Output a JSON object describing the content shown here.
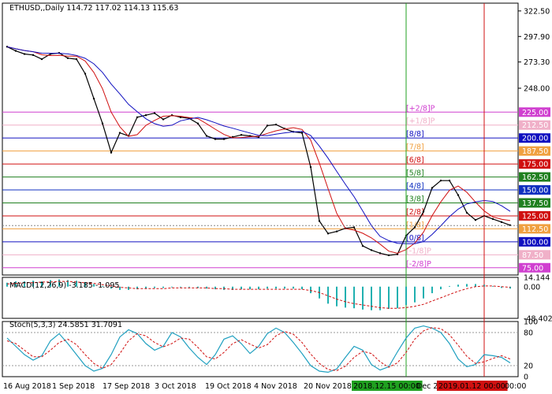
{
  "chart_data": {
    "type": "line",
    "symbol": "ETHUSD",
    "timeframe": "Daily",
    "ohlc_header": "ETHUSD,,Daily  114.72 117.02 114.13 115.63",
    "price_ylim": [
      68,
      330
    ],
    "price_ticks": [
      {
        "value": 322.5,
        "label": "322.50"
      },
      {
        "value": 297.9,
        "label": "297.90"
      },
      {
        "value": 273.3,
        "label": "273.30"
      },
      {
        "value": 248.0,
        "label": "248.00"
      }
    ],
    "current_price": {
      "value": 115.63,
      "label": "115.63"
    },
    "murrey_levels": [
      {
        "value": 225.0,
        "name": "[+2/8]P",
        "price_label": "225.00",
        "color": "#d040d0"
      },
      {
        "value": 212.5,
        "name": "[+1/8]P",
        "price_label": "212.50",
        "color": "#f0b0c8"
      },
      {
        "value": 200.0,
        "name": "[8/8]",
        "price_label": "200.00",
        "color": "#1010c0"
      },
      {
        "value": 187.5,
        "name": "[7/8]",
        "price_label": "187.50",
        "color": "#f0a040"
      },
      {
        "value": 175.0,
        "name": "[6/8]",
        "price_label": "175.00",
        "color": "#d01010"
      },
      {
        "value": 162.5,
        "name": "[5/8]",
        "price_label": "162.50",
        "color": "#208020"
      },
      {
        "value": 150.0,
        "name": "[4/8]",
        "price_label": "150.00",
        "color": "#1030c0"
      },
      {
        "value": 137.5,
        "name": "[3/8]",
        "price_label": "137.50",
        "color": "#208020"
      },
      {
        "value": 125.0,
        "name": "[2/8]",
        "price_label": "125.00",
        "color": "#d01010"
      },
      {
        "value": 112.5,
        "name": "[1/8]",
        "price_label": "112.50",
        "color": "#f0a040"
      },
      {
        "value": 100.0,
        "name": "[0/8]",
        "price_label": "100.00",
        "color": "#1010c0"
      },
      {
        "value": 87.5,
        "name": "[-1/8]P",
        "price_label": "87.50",
        "color": "#f0b0c8"
      },
      {
        "value": 75.0,
        "name": "[-2/8]P",
        "price_label": "75.00",
        "color": "#d040d0"
      }
    ],
    "x_labels": [
      "16 Aug 2018",
      "1 Sep 2018",
      "17 Sep 2018",
      "3 Oct 2018",
      "19 Oct 2018",
      "4 Nov 2018",
      "20 Nov 2018",
      "2018.12.15 00:00",
      "Dec 2",
      "2019.01.12 00:00",
      "00:00"
    ],
    "close_series": [
      288,
      284,
      281,
      280,
      276,
      281,
      282,
      277,
      276,
      262,
      238,
      214,
      186,
      205,
      202,
      220,
      222,
      224,
      218,
      222,
      220,
      219,
      214,
      202,
      199,
      199,
      201,
      203,
      202,
      201,
      212,
      213,
      209,
      206,
      205,
      172,
      120,
      108,
      110,
      113,
      114,
      96,
      92,
      89,
      87,
      88,
      106,
      114,
      129,
      152,
      159,
      159,
      145,
      128,
      121,
      125,
      122,
      119,
      116
    ],
    "macd": {
      "label": "MACD(12,26,9) -3.185 -1.095",
      "ticks": [
        "14.144",
        "0.00",
        "-48.402"
      ],
      "ylim": [
        -48.402,
        14.144
      ],
      "histogram": [
        6,
        8,
        8,
        9,
        8,
        10,
        11,
        10,
        9,
        7,
        4,
        1,
        -3,
        -5,
        -5,
        -4,
        -3,
        -2,
        -2,
        -1,
        -1,
        -1,
        -2,
        -3,
        -4,
        -5,
        -5,
        -4,
        -4,
        -4,
        -3,
        -3,
        -3,
        -3,
        -4,
        -10,
        -18,
        -26,
        -30,
        -32,
        -33,
        -35,
        -36,
        -36,
        -34,
        -33,
        -28,
        -24,
        -18,
        -10,
        -4,
        1,
        3,
        4,
        4,
        3,
        1,
        -2,
        -3
      ],
      "signal": [
        4,
        5,
        6,
        6,
        7,
        7,
        8,
        8,
        7,
        6,
        5,
        3,
        1,
        -1,
        -2,
        -3,
        -3,
        -3,
        -3,
        -2,
        -2,
        -2,
        -2,
        -2,
        -3,
        -3,
        -4,
        -4,
        -4,
        -4,
        -4,
        -4,
        -4,
        -4,
        -4,
        -6,
        -9,
        -14,
        -19,
        -23,
        -26,
        -28,
        -30,
        -32,
        -33,
        -33,
        -32,
        -30,
        -27,
        -22,
        -17,
        -12,
        -7,
        -3,
        0,
        1,
        1,
        0,
        -1
      ]
    },
    "stoch": {
      "label": "Stoch(5,3,3) 24.5851 31.7091",
      "ticks": [
        "100",
        "80",
        "20",
        "0"
      ],
      "ylim": [
        0,
        100
      ],
      "main": [
        70,
        55,
        40,
        30,
        38,
        65,
        78,
        60,
        40,
        20,
        10,
        15,
        40,
        72,
        85,
        78,
        60,
        48,
        55,
        80,
        72,
        52,
        35,
        22,
        40,
        68,
        74,
        60,
        42,
        55,
        78,
        88,
        80,
        62,
        42,
        20,
        10,
        8,
        14,
        35,
        55,
        48,
        22,
        12,
        18,
        45,
        70,
        88,
        92,
        88,
        80,
        60,
        32,
        18,
        22,
        40,
        38,
        35,
        25
      ],
      "signal": [
        65,
        60,
        48,
        36,
        36,
        48,
        62,
        68,
        58,
        40,
        24,
        15,
        22,
        42,
        65,
        78,
        74,
        62,
        54,
        60,
        70,
        68,
        53,
        36,
        32,
        44,
        60,
        67,
        59,
        52,
        58,
        74,
        82,
        77,
        62,
        41,
        24,
        13,
        11,
        19,
        35,
        46,
        42,
        27,
        17,
        25,
        44,
        68,
        83,
        89,
        87,
        76,
        57,
        37,
        24,
        27,
        33,
        38,
        32
      ]
    }
  }
}
